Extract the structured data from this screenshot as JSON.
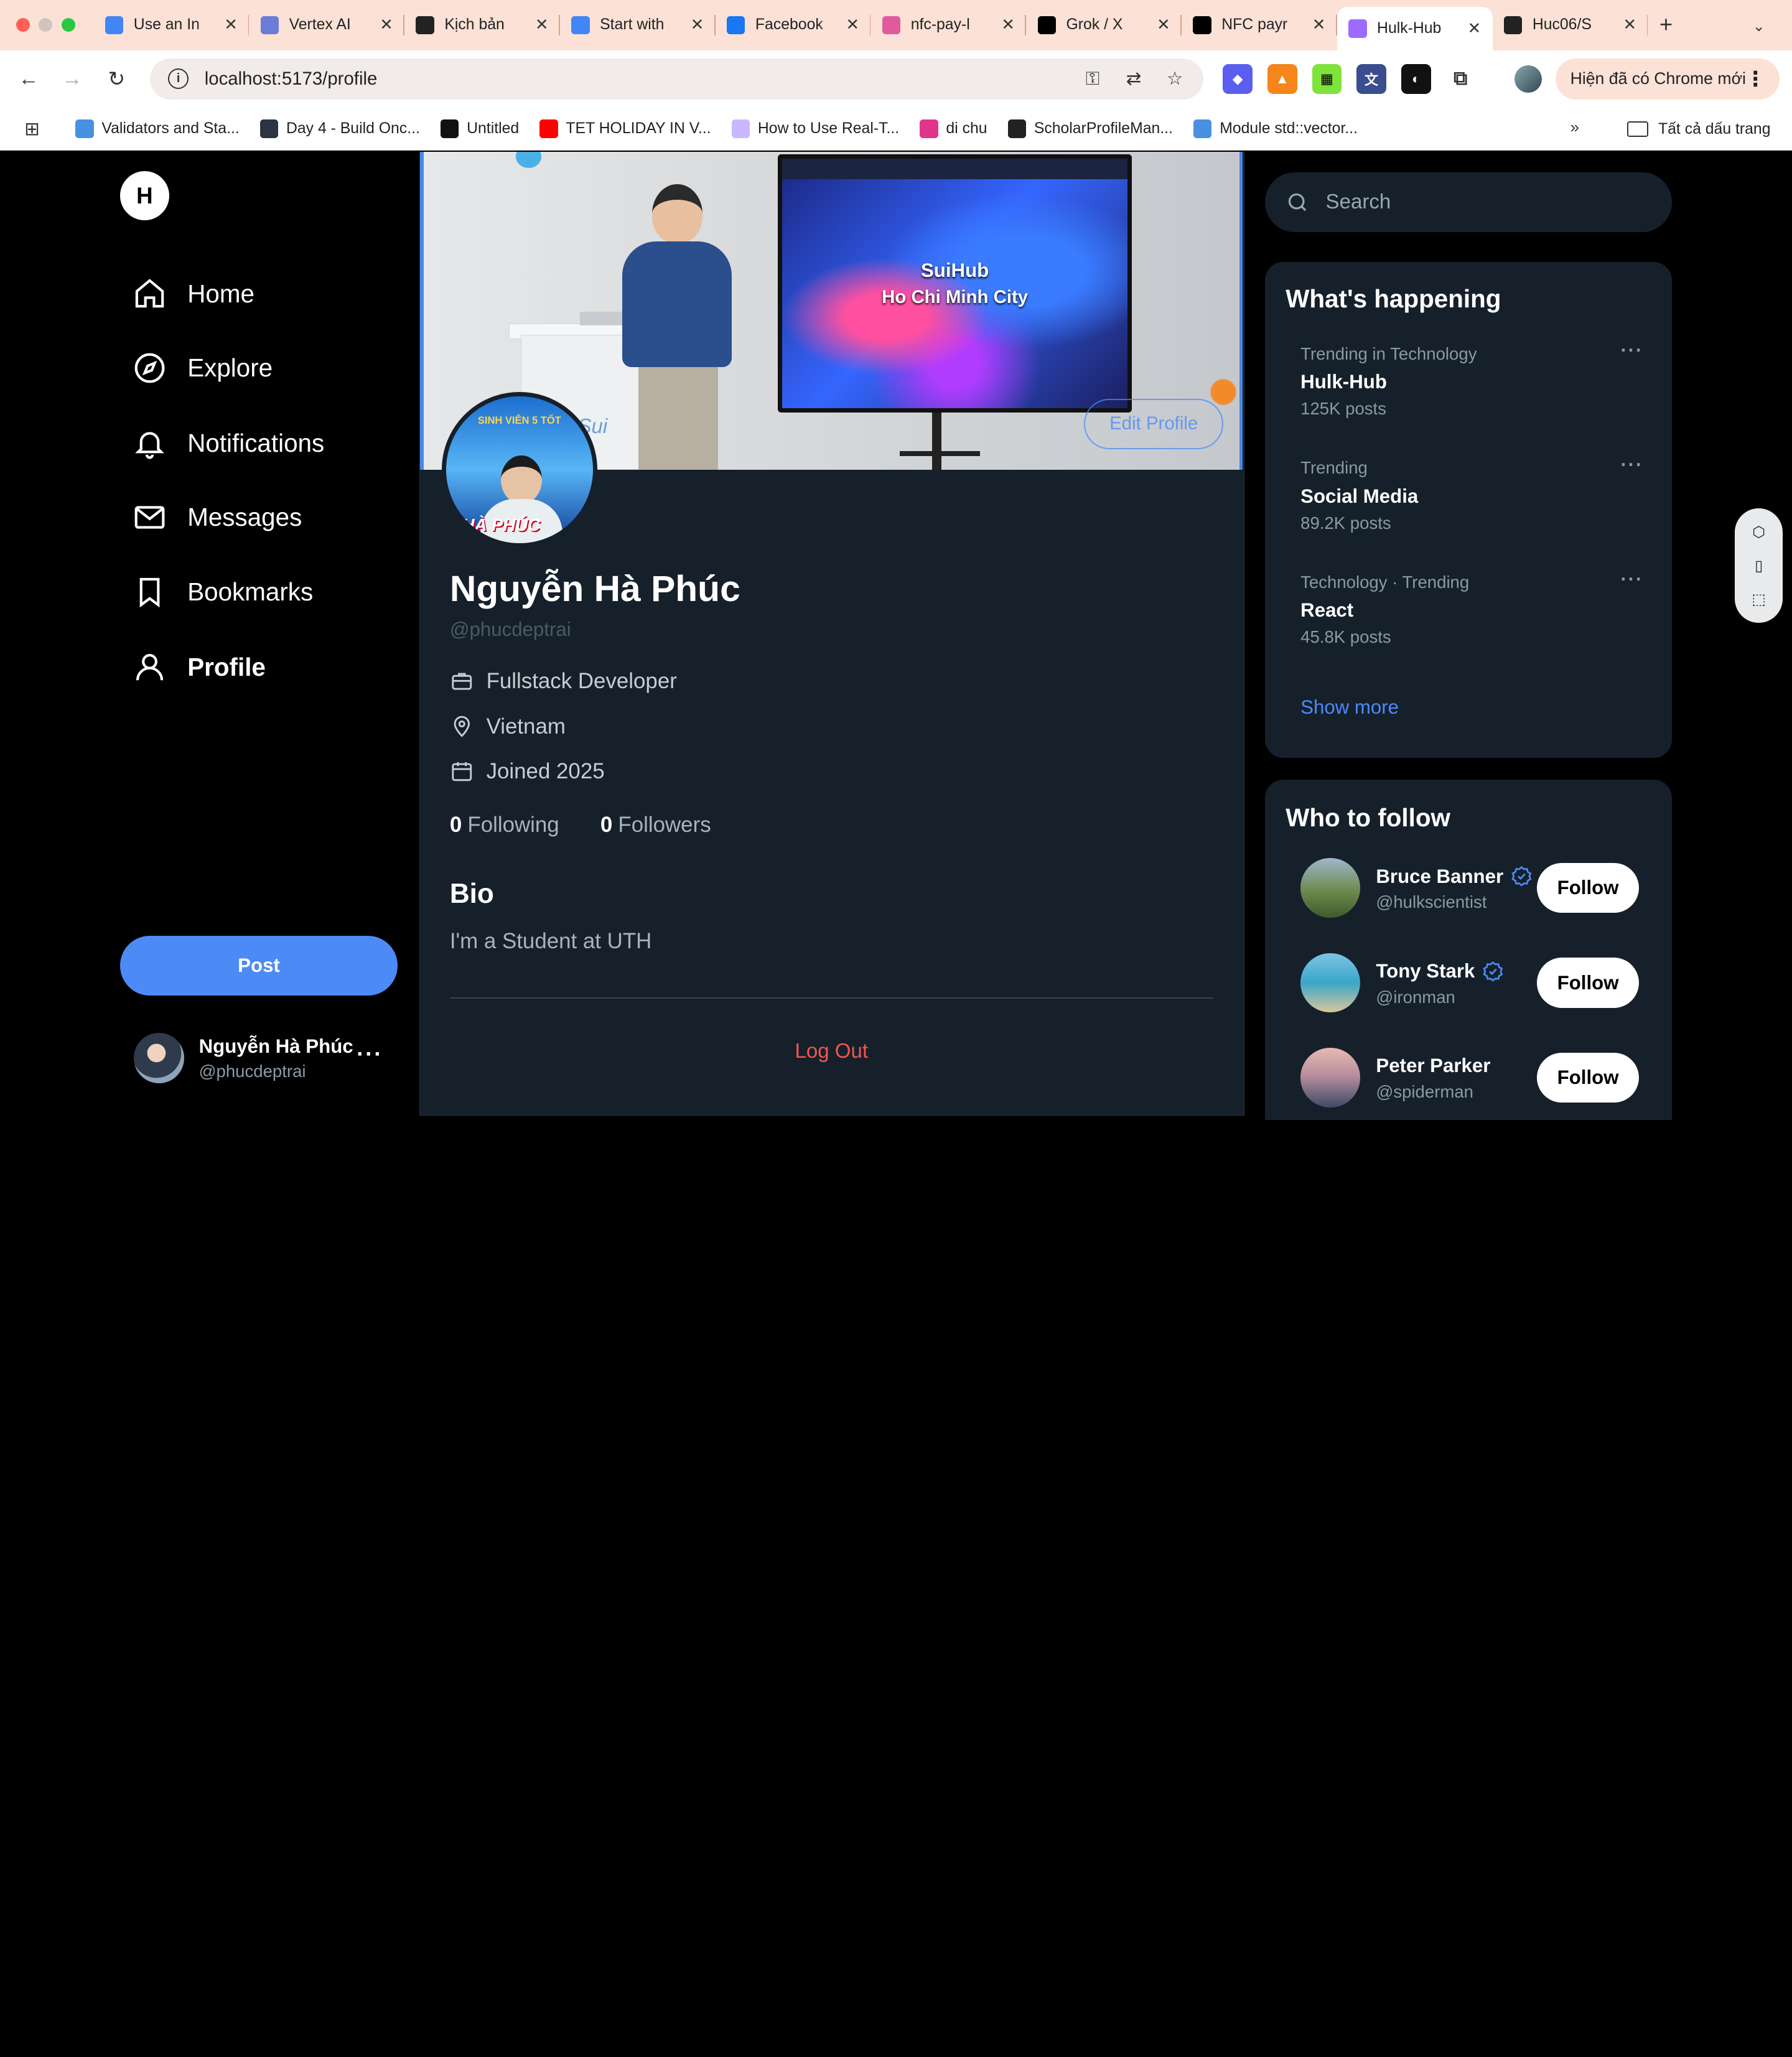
{
  "browser": {
    "tabs": [
      {
        "title": "Use an In",
        "icon": "google-cloud-icon",
        "color": "#4285f4"
      },
      {
        "title": "Vertex AI",
        "icon": "vertex-ai-icon",
        "color": "#6b7bd8"
      },
      {
        "title": "Kịch bản",
        "icon": "openai-icon",
        "color": "#222222"
      },
      {
        "title": "Start with",
        "icon": "google-cloud-icon",
        "color": "#4285f4"
      },
      {
        "title": "Facebook",
        "icon": "facebook-icon",
        "color": "#1877f2"
      },
      {
        "title": "nfc-pay-l",
        "icon": "pink-app-icon",
        "color": "#e05a9c"
      },
      {
        "title": "Grok / X",
        "icon": "x-icon",
        "color": "#000000"
      },
      {
        "title": "NFC payr",
        "icon": "vercel-icon",
        "color": "#000000"
      },
      {
        "title": "Hulk-Hub",
        "icon": "vite-icon",
        "color": "#9c6bff",
        "active": true
      },
      {
        "title": "Huc06/S",
        "icon": "github-icon",
        "color": "#222222"
      }
    ],
    "url": "localhost:5173/profile",
    "update_text": "Hiện đã có Chrome mới",
    "bookmarks": [
      {
        "title": "Validators and Sta...",
        "icon": "drop-icon",
        "color": "#4a90e2"
      },
      {
        "title": "Day 4 - Build Onc...",
        "icon": "dark-circle-icon",
        "color": "#2b3440"
      },
      {
        "title": "Untitled",
        "icon": "grid-icon",
        "color": "#111111"
      },
      {
        "title": "TET HOLIDAY IN V...",
        "icon": "youtube-icon",
        "color": "#ff0000"
      },
      {
        "title": "How to Use Real-T...",
        "icon": "spiral-icon",
        "color": "#c9b7ff"
      },
      {
        "title": "di chu",
        "icon": "chart-icon",
        "color": "#e0358a"
      },
      {
        "title": "ScholarProfileMan...",
        "icon": "github-icon",
        "color": "#222222"
      },
      {
        "title": "Module std::vector...",
        "icon": "drop-icon",
        "color": "#4a90e2"
      }
    ],
    "all_bookmarks": "Tất cả dấu trang"
  },
  "sidebar": {
    "logo": "H",
    "nav": [
      {
        "label": "Home",
        "icon": "home-icon"
      },
      {
        "label": "Explore",
        "icon": "compass-icon"
      },
      {
        "label": "Notifications",
        "icon": "bell-icon"
      },
      {
        "label": "Messages",
        "icon": "mail-icon"
      },
      {
        "label": "Bookmarks",
        "icon": "bookmark-icon"
      },
      {
        "label": "Profile",
        "icon": "user-icon",
        "active": true
      }
    ],
    "post_label": "Post",
    "user": {
      "name": "Nguyễn Hà Phúc",
      "handle": "@phucdeptrai"
    }
  },
  "profile": {
    "banner_screen_title": "SuiHub",
    "banner_screen_subtitle": "Ho Chi Minh City",
    "banner_sui_text": "Sui",
    "avatar_caption_top": "SINH VIÊN 5 TỐT",
    "avatar_caption_bottom": "HÀ PHÚC",
    "edit_label": "Edit Profile",
    "name": "Nguyễn Hà Phúc",
    "handle": "@phucdeptrai",
    "occupation": "Fullstack Developer",
    "location": "Vietnam",
    "joined": "Joined 2025",
    "following_count": "0",
    "following_label": "Following",
    "followers_count": "0",
    "followers_label": "Followers",
    "bio_title": "Bio",
    "bio_text": "I'm a Student at UTH",
    "logout_label": "Log Out"
  },
  "right": {
    "search_placeholder": "Search",
    "happening_title": "What's happening",
    "trends": [
      {
        "category": "Trending in Technology",
        "name": "Hulk-Hub",
        "posts": "125K posts"
      },
      {
        "category": "Trending",
        "name": "Social Media",
        "posts": "89.2K posts"
      },
      {
        "category": "Technology · Trending",
        "name": "React",
        "posts": "45.8K posts"
      }
    ],
    "show_more": "Show more",
    "follow_title": "Who to follow",
    "follow_label": "Follow",
    "suggestions": [
      {
        "name": "Bruce Banner",
        "handle": "@hulkscientist",
        "verified": true
      },
      {
        "name": "Tony Stark",
        "handle": "@ironman",
        "verified": true
      },
      {
        "name": "Peter Parker",
        "handle": "@spiderman",
        "verified": false
      }
    ]
  },
  "colors": {
    "accent": "#4c8bf5",
    "danger": "#f4554e",
    "card_bg": "#15202b"
  }
}
